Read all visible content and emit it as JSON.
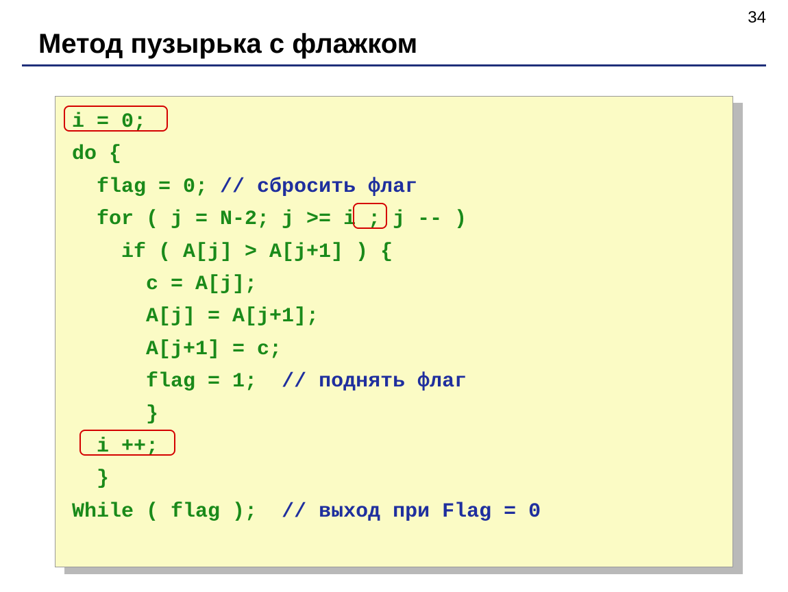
{
  "slide": {
    "number": "34",
    "title": "Метод пузырька с флажком"
  },
  "code": {
    "l01": "i = 0;",
    "l02": "do {",
    "l03a": "  flag = 0; ",
    "l03b": "// сбросить флаг",
    "l04a": "  for ( j = N-2; j >= ",
    "l04b": "i",
    "l04c": " ; j -- )",
    "l05": "    if ( A[j] > A[j+1] ) {",
    "l06": "      с = A[j];",
    "l07": "      A[j] = A[j+1];",
    "l08": "      A[j+1] = с;",
    "l09a": "      flag = 1;  ",
    "l09b": "// поднять флаг",
    "l10": "      }",
    "l11": "  i ++;",
    "l12": "  }",
    "l13a": "While ( flag );  ",
    "l13b": "// выход при Flag = 0"
  }
}
